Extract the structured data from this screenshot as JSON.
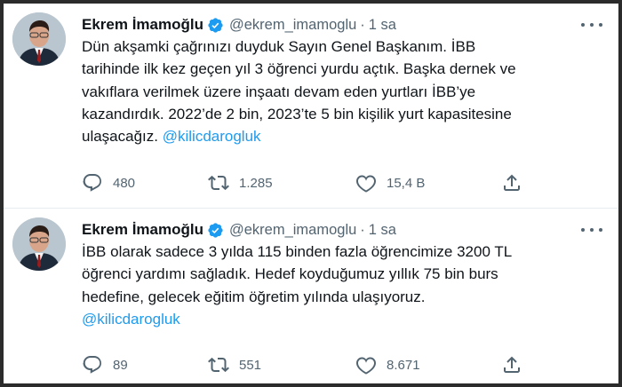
{
  "tweets": [
    {
      "author": {
        "name": "Ekrem İmamoğlu",
        "handle": "@ekrem_imamoglu",
        "separator": "·",
        "time": "1 sa",
        "avatar_icon": "person-avatar"
      },
      "text_lines": [
        "Dün akşamki çağrınızı duyduk Sayın Genel Başkanım. İBB",
        "tarihinde ilk kez geçen yıl 3 öğrenci yurdu açtık. Başka dernek ve",
        "vakıflara verilmek üzere inşaatı devam eden yurtları İBB’ye",
        "kazandırdık. 2022’de 2 bin, 2023’te 5 bin kişilik yurt kapasitesine",
        "ulaşacağız."
      ],
      "mention": "@kilicdarogluk",
      "stats": {
        "replies": "480",
        "retweets": "1.285",
        "likes": "15,4 B"
      }
    },
    {
      "author": {
        "name": "Ekrem İmamoğlu",
        "handle": "@ekrem_imamoglu",
        "separator": "·",
        "time": "1 sa",
        "avatar_icon": "person-avatar"
      },
      "text_lines": [
        "İBB olarak sadece 3 yılda 115 binden fazla öğrencimize 3200 TL",
        "öğrenci yardımı sağladık. Hedef koyduğumuz yıllık 75 bin burs",
        "hedefine, gelecek eğitim öğretim yılında ulaşıyoruz."
      ],
      "mention": "@kilicdarogluk",
      "stats": {
        "replies": "89",
        "retweets": "551",
        "likes": "8.671"
      }
    }
  ],
  "colors": {
    "text": "#0f1419",
    "secondary": "#536471",
    "link": "#1d9bf0",
    "verified": "#1d9bf0",
    "divider": "#e6ecf0"
  },
  "icons": [
    "verified-badge-icon",
    "more-icon",
    "reply-icon",
    "retweet-icon",
    "like-icon",
    "share-icon"
  ]
}
